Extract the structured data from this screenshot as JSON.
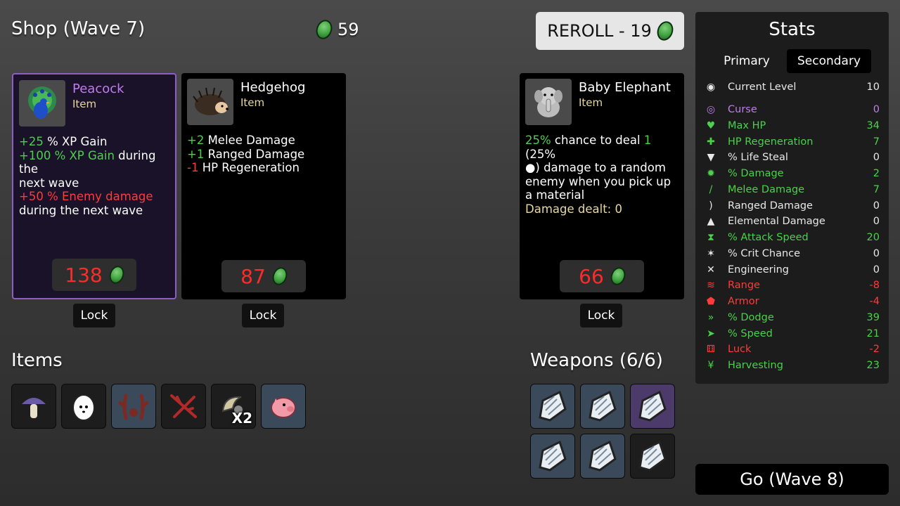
{
  "header": {
    "title": "Shop (Wave 7)",
    "money": "59",
    "reroll_label": "REROLL - 19"
  },
  "cards": [
    {
      "name": "Peacock",
      "type": "Item",
      "icon": "peacock-icon",
      "price": "138",
      "lock_label": "Lock",
      "lines": [
        [
          {
            "t": "+25",
            "c": "g"
          },
          {
            "t": " % XP Gain",
            "c": ""
          }
        ],
        [
          {
            "t": "+100 % XP Gain",
            "c": "g"
          },
          {
            "t": " during the",
            "c": ""
          }
        ],
        [
          {
            "t": "next wave",
            "c": ""
          }
        ],
        [
          {
            "t": "+50 % Enemy damage",
            "c": "r"
          }
        ],
        [
          {
            "t": "during the next wave",
            "c": ""
          }
        ]
      ]
    },
    {
      "name": "Hedgehog",
      "type": "Item",
      "icon": "hedgehog-icon",
      "price": "87",
      "lock_label": "Lock",
      "lines": [
        [
          {
            "t": "+2",
            "c": "g"
          },
          {
            "t": " Melee Damage",
            "c": ""
          }
        ],
        [
          {
            "t": "+1",
            "c": "g"
          },
          {
            "t": " Ranged Damage",
            "c": ""
          }
        ],
        [
          {
            "t": "-1",
            "c": "r"
          },
          {
            "t": " HP Regeneration",
            "c": ""
          }
        ]
      ]
    },
    {
      "name": "Baby Elephant",
      "type": "Item",
      "icon": "baby-elephant-icon",
      "price": "66",
      "lock_label": "Lock",
      "lines": [
        [
          {
            "t": "25%",
            "c": "g"
          },
          {
            "t": " chance to deal ",
            "c": ""
          },
          {
            "t": "1",
            "c": "g"
          },
          {
            "t": " (25%",
            "c": ""
          }
        ],
        [
          {
            "t": "●",
            "c": ""
          },
          {
            "t": ") damage to a random",
            "c": ""
          }
        ],
        [
          {
            "t": "enemy when you pick up",
            "c": ""
          }
        ],
        [
          {
            "t": "a material",
            "c": ""
          }
        ],
        [
          {
            "t": "Damage dealt: 0",
            "c": "y"
          }
        ]
      ]
    }
  ],
  "items_section": {
    "title": "Items",
    "slots": [
      {
        "icon": "mushroom-icon",
        "bg": "dark",
        "count": ""
      },
      {
        "icon": "egg-icon",
        "bg": "dark",
        "count": ""
      },
      {
        "icon": "antlers-icon",
        "bg": "blue",
        "count": ""
      },
      {
        "icon": "thorns-icon",
        "bg": "dark",
        "count": ""
      },
      {
        "icon": "horn-icon",
        "bg": "dark",
        "count": "X2"
      },
      {
        "icon": "piggy-bank-icon",
        "bg": "blue",
        "count": ""
      }
    ]
  },
  "weapons_section": {
    "title": "Weapons (6/6)",
    "slots": [
      {
        "icon": "claw-weapon-icon",
        "bg": "blue"
      },
      {
        "icon": "claw-weapon-icon",
        "bg": "blue"
      },
      {
        "icon": "claw-weapon-icon",
        "bg": "purple"
      },
      {
        "icon": "claw-weapon-icon",
        "bg": "blue"
      },
      {
        "icon": "claw-weapon-icon",
        "bg": "blue"
      },
      {
        "icon": "claw-weapon-icon",
        "bg": "dark"
      }
    ]
  },
  "stats": {
    "title": "Stats",
    "tab_primary": "Primary",
    "tab_secondary": "Secondary",
    "rows": [
      {
        "label": "Current Level",
        "value": "10",
        "color": "#e8e8e8",
        "icon": "level-icon"
      },
      {
        "label": "Curse",
        "value": "0",
        "color": "#c07cf0",
        "icon": "curse-icon"
      },
      {
        "label": "Max HP",
        "value": "34",
        "color": "#4bd14b",
        "icon": "heart-icon"
      },
      {
        "label": "HP Regeneration",
        "value": "7",
        "color": "#4bd14b",
        "icon": "regen-icon"
      },
      {
        "label": "% Life Steal",
        "value": "0",
        "color": "#e8e8e8",
        "icon": "life-steal-icon"
      },
      {
        "label": "% Damage",
        "value": "2",
        "color": "#4bd14b",
        "icon": "damage-icon"
      },
      {
        "label": "Melee Damage",
        "value": "7",
        "color": "#4bd14b",
        "icon": "sword-icon"
      },
      {
        "label": "Ranged Damage",
        "value": "0",
        "color": "#e8e8e8",
        "icon": "bow-icon"
      },
      {
        "label": "Elemental Damage",
        "value": "0",
        "color": "#e8e8e8",
        "icon": "flame-icon"
      },
      {
        "label": "% Attack Speed",
        "value": "20",
        "color": "#4bd14b",
        "icon": "hourglass-icon"
      },
      {
        "label": "% Crit Chance",
        "value": "0",
        "color": "#e8e8e8",
        "icon": "crit-icon"
      },
      {
        "label": "Engineering",
        "value": "0",
        "color": "#e8e8e8",
        "icon": "wrench-icon"
      },
      {
        "label": "Range",
        "value": "-8",
        "color": "#ff3b3b",
        "icon": "range-icon"
      },
      {
        "label": "Armor",
        "value": "-4",
        "color": "#ff3b3b",
        "icon": "shield-icon"
      },
      {
        "label": "% Dodge",
        "value": "39",
        "color": "#4bd14b",
        "icon": "dodge-icon"
      },
      {
        "label": "% Speed",
        "value": "21",
        "color": "#4bd14b",
        "icon": "speed-icon"
      },
      {
        "label": "Luck",
        "value": "-2",
        "color": "#ff3b3b",
        "icon": "dice-icon"
      },
      {
        "label": "Harvesting",
        "value": "23",
        "color": "#4bd14b",
        "icon": "wheat-icon"
      }
    ]
  },
  "go_label": "Go (Wave 8)"
}
